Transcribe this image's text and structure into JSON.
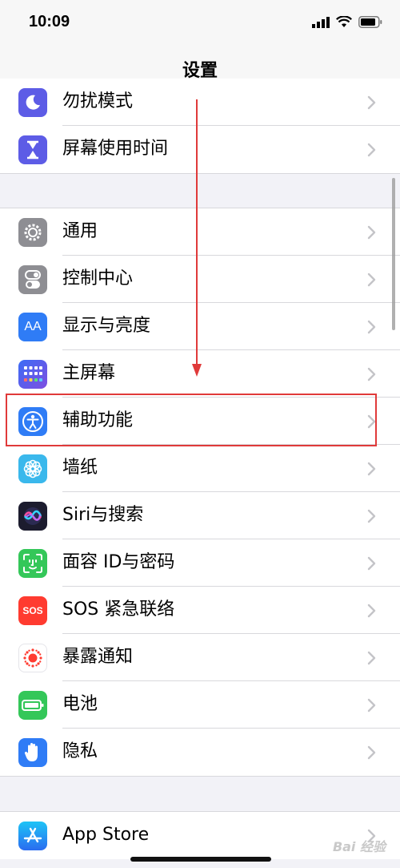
{
  "status_bar": {
    "time": "10:09"
  },
  "nav": {
    "title": "设置"
  },
  "groups": [
    {
      "items": [
        {
          "label": "勿扰模式",
          "icon": "moon-icon",
          "color": "#5d5ce6"
        },
        {
          "label": "屏幕使用时间",
          "icon": "hourglass-icon",
          "color": "#5d5ce6"
        }
      ]
    },
    {
      "items": [
        {
          "label": "通用",
          "icon": "gear-icon",
          "color": "#8e8e93"
        },
        {
          "label": "控制中心",
          "icon": "toggles-icon",
          "color": "#8e8e93"
        },
        {
          "label": "显示与亮度",
          "icon": "text-size-icon",
          "color": "#2f7cf6"
        },
        {
          "label": "主屏幕",
          "icon": "home-grid-icon",
          "color": "#2f7cf6"
        },
        {
          "label": "辅助功能",
          "icon": "accessibility-icon",
          "color": "#2f7cf6"
        },
        {
          "label": "墙纸",
          "icon": "flower-icon",
          "color": "#3ab8ec"
        },
        {
          "label": "Siri与搜索",
          "icon": "siri-icon",
          "color": "#1c1c2e"
        },
        {
          "label": "面容 ID与密码",
          "icon": "face-id-icon",
          "color": "#34c759"
        },
        {
          "label": "SOS 紧急联络",
          "icon": "sos-icon",
          "color": "#ff3b30"
        },
        {
          "label": "暴露通知",
          "icon": "exposure-icon",
          "color": "#ffffff"
        },
        {
          "label": "电池",
          "icon": "battery-icon",
          "color": "#34c759"
        },
        {
          "label": "隐私",
          "icon": "hand-icon",
          "color": "#2f7cf6"
        }
      ]
    },
    {
      "items": [
        {
          "label": "App Store",
          "icon": "app-store-icon",
          "color": "#2f8cf6"
        }
      ]
    }
  ],
  "icon_text": {
    "text_size": "AA",
    "sos": "SOS"
  },
  "annotation": {
    "highlight_color": "#e03a3a",
    "highlighted_item": "辅助功能"
  },
  "watermark": {
    "text": "Bai 经验"
  }
}
